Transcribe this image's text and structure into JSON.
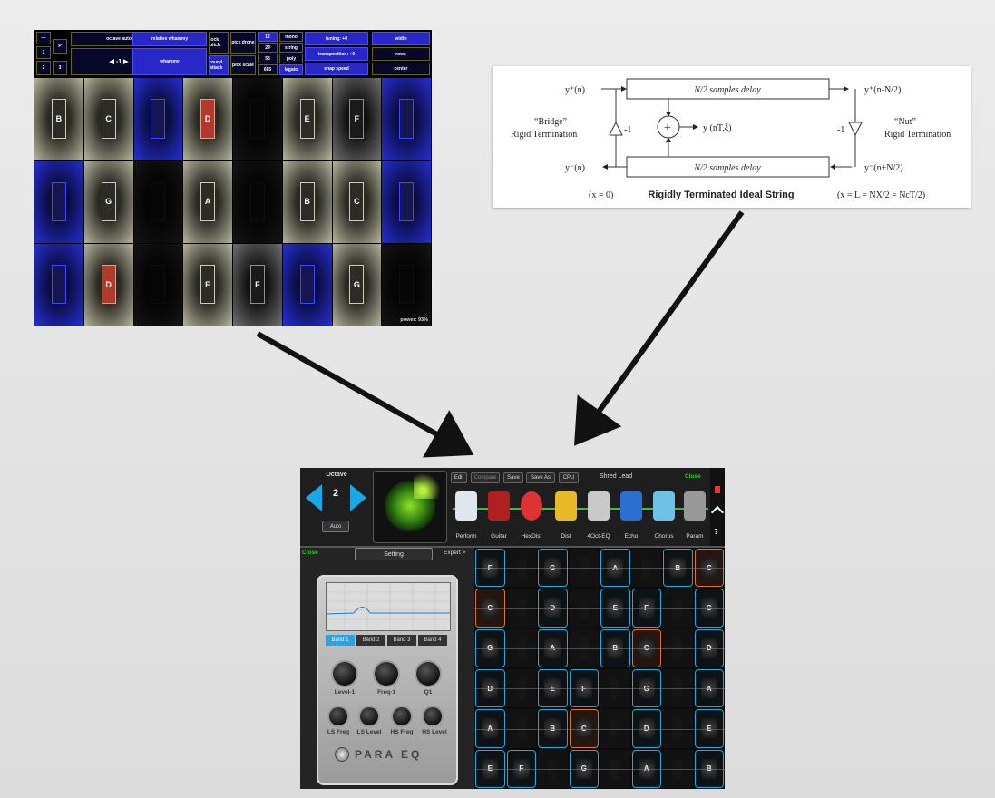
{
  "grid_app": {
    "toolbar": {
      "minus": "—",
      "p": "P",
      "one": "1",
      "two": "2",
      "three": "3",
      "octave_auto": "octave auto",
      "octave_value": "◀  -1  ▶",
      "relative_whammy": "relative whammy",
      "whammy": "whammy",
      "lock_pitch": "lock pitch",
      "round_attack": "round attack",
      "pick_drone": "pick drone",
      "pick_scale": "pick scale",
      "n12": "12",
      "n24": "24",
      "n53": "53",
      "n665": "665",
      "mono": "mono",
      "string": "string",
      "poly": "poly",
      "legato": "legato",
      "tuning": "tuning: +0",
      "transposition": "transposition: +0",
      "snap_speed": "snap speed",
      "width": "width",
      "rows": "rows",
      "center": "center"
    },
    "pads": [
      [
        "B",
        "C",
        "",
        "D",
        "",
        "E",
        "F",
        ""
      ],
      [
        "",
        "G",
        "",
        "A",
        "",
        "B",
        "C",
        ""
      ],
      [
        "",
        "D",
        "",
        "E",
        "F",
        "",
        "G",
        ""
      ]
    ],
    "power": "power: 93%"
  },
  "string_diagram": {
    "y_plus_n": "y⁺(n)",
    "y_plus_n_n2": "y⁺(n-N/2)",
    "y_minus_n": "y⁻(n)",
    "y_minus_n_n2": "y⁻(n+N/2)",
    "delay_top": "N/2 samples delay",
    "delay_bottom": "N/2 samples delay",
    "output": "y (nT,ξ)",
    "plus": "+",
    "gain_left": "-1",
    "gain_right": "-1",
    "bridge_line1": "“Bridge”",
    "bridge_line2": "Rigid Termination",
    "nut_line1": "“Nut”",
    "nut_line2": "Rigid Termination",
    "x0": "(x = 0)",
    "title": "Rigidly Terminated Ideal String",
    "xl": "(x = L = NX/2 = NcT/2)"
  },
  "ipad_app": {
    "octave_label": "Octave",
    "octave_value": "2",
    "auto": "Auto",
    "buttons": {
      "edit": "Edit",
      "compare": "Compare",
      "save": "Save",
      "save_as": "Save As",
      "cpu": "CPU"
    },
    "preset": "Shred Lead",
    "close_top": "Close",
    "chain": [
      "Perform",
      "Guitar",
      "HexDist",
      "Dist",
      "4Oct-EQ",
      "Echo",
      "Chorus",
      "Param"
    ],
    "question": "?",
    "close": "Close",
    "setting": "Setting",
    "expert": "Expert >",
    "bands": [
      "Band 1",
      "Band 2",
      "Band 3",
      "Band 4"
    ],
    "knobs_top": [
      "Level-1",
      "Freq-1",
      "Q1"
    ],
    "knobs_bottom": [
      "LS Freq",
      "LS Level",
      "HS Freq",
      "HS Level"
    ],
    "pedal_name": "PARA EQ",
    "fretboard": [
      [
        "F",
        "",
        "G",
        "",
        "A",
        "",
        "B",
        "C"
      ],
      [
        "C",
        "",
        "D",
        "",
        "E",
        "F",
        "",
        "G"
      ],
      [
        "G",
        "",
        "A",
        "",
        "B",
        "C",
        "",
        "D"
      ],
      [
        "D",
        "",
        "E",
        "F",
        "",
        "G",
        "",
        "A"
      ],
      [
        "A",
        "",
        "B",
        "C",
        "",
        "D",
        "",
        "E"
      ],
      [
        "E",
        "F",
        "",
        "G",
        "",
        "A",
        "",
        "B"
      ]
    ]
  }
}
